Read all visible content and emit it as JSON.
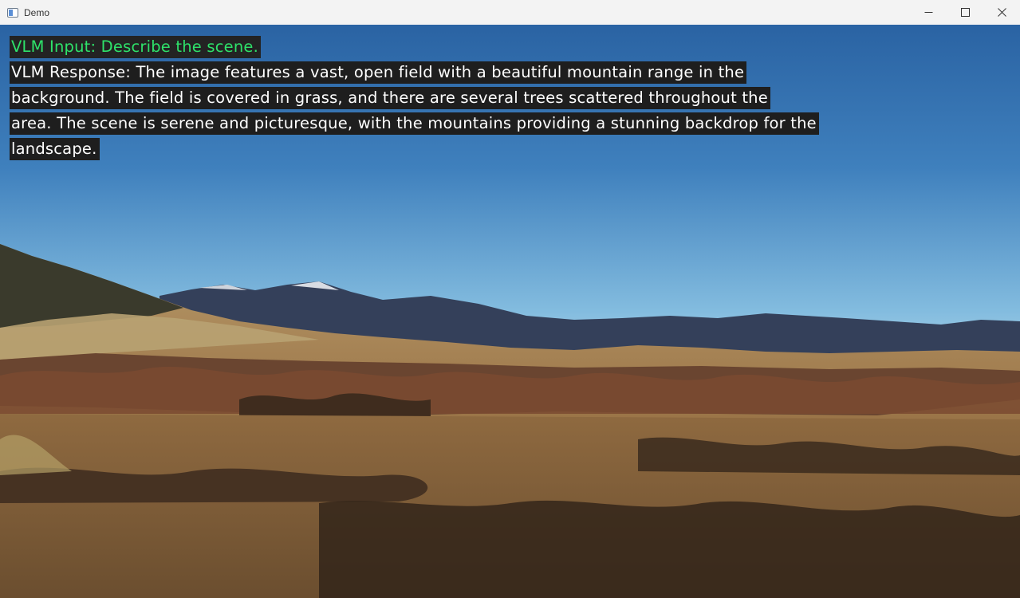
{
  "window": {
    "title": "Demo",
    "controls": {
      "minimize_icon": "minimize-icon",
      "maximize_icon": "maximize-icon",
      "close_icon": "close-icon"
    }
  },
  "overlay": {
    "input_text": "VLM Input: Describe the scene.",
    "response_lines": [
      "VLM Response: The image features a vast, open field with a beautiful mountain range in the",
      "background. The field is covered in grass, and there are several trees scattered throughout the",
      "area. The scene is serene and picturesque, with the mountains providing a stunning backdrop for the",
      "landscape."
    ],
    "colors": {
      "input_text": "#2ee26a",
      "response_text": "#ffffff",
      "label_background": "#1e1e1e"
    }
  },
  "scene": {
    "description_type": "landscape-photo",
    "colors": {
      "sky_top": "#2f6aa8",
      "sky_bottom": "#8ec2e0",
      "mountains": "#2c3a52",
      "field": "#a9824f"
    }
  }
}
